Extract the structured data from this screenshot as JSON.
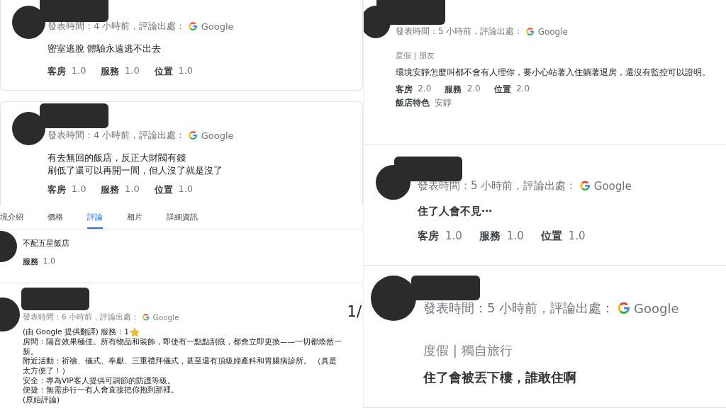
{
  "left_column": [
    {
      "meta": "發表時間：4 小時前，評論出處：",
      "source": "Google",
      "lines": [
        "密室逃脫 體驗永遠逃不出去"
      ],
      "ratings": [
        {
          "label": "客房",
          "value": "1.0"
        },
        {
          "label": "服務",
          "value": "1.0"
        },
        {
          "label": "位置",
          "value": "1.0"
        }
      ]
    },
    {
      "meta": "發表時間：4 小時前，評論出處：",
      "source": "Google",
      "lines": [
        "有去無回的飯店，反正大財閥有錢",
        "刷低了還可以再開一間，但人沒了就是沒了"
      ],
      "ratings": [
        {
          "label": "客房",
          "value": "1.0"
        },
        {
          "label": "服務",
          "value": "1.0"
        },
        {
          "label": "位置",
          "value": "1.0"
        }
      ]
    },
    {
      "tabs": [
        {
          "label": "境介紹",
          "selected": false
        },
        {
          "label": "價格",
          "selected": false
        },
        {
          "label": "評論",
          "selected": true
        },
        {
          "label": "相片",
          "selected": false
        },
        {
          "label": "詳細資訊",
          "selected": false
        }
      ],
      "lines": [
        "不配五星飯店"
      ],
      "ratings": [
        {
          "label": "服務",
          "value": "1.0"
        }
      ]
    },
    {
      "meta": "發表時間：6 小時前，評論出處：",
      "source": "Google",
      "page_indicator": "1/",
      "translated_rating": {
        "text": "(由 Google 提供翻譯) 服務：1"
      },
      "lines": [
        "房間：隔音效果極佳。所有物品和裝飾，即使有一點點刮痕，都會立即更換——一切都煥然一新。",
        "附近活動：祈禱、儀式、奉獻、三重禮拜儀式，甚至還有頂級婦產科和胃腸病診所。 （真是太方便了！）",
        "安全：專為VIP客人提供可調節的防護等級。",
        "便捷：無需步行一有人會直接把你抱到那裡。",
        "(原始評論)"
      ]
    }
  ],
  "right_column": [
    {
      "meta": "發表時間：5 小時前，評論出處：",
      "source": "Google",
      "tags": "度假 | 朋友",
      "lines": [
        "環境安靜怎麼叫都不會有人理你，要小心站著入住躺著退房，還沒有監控可以證明。"
      ],
      "ratings": [
        {
          "label": "客房",
          "value": "2.0"
        },
        {
          "label": "服務",
          "value": "2.0"
        },
        {
          "label": "位置",
          "value": "2.0"
        }
      ],
      "features": {
        "label": "飯店特色",
        "value": "安靜"
      }
    },
    {
      "meta": "發表時間：5 小時前，評論出處：",
      "source": "Google",
      "lines": [
        "住了人會不見⋯"
      ],
      "ratings": [
        {
          "label": "客房",
          "value": "1.0"
        },
        {
          "label": "服務",
          "value": "1.0"
        },
        {
          "label": "位置",
          "value": "1.0"
        }
      ]
    },
    {
      "meta": "發表時間：5 小時前，評論出處：",
      "source": "Google",
      "tags": "度假 | 獨自旅行",
      "lines": [
        "住了會被丟下樓，誰敢住啊"
      ]
    }
  ]
}
